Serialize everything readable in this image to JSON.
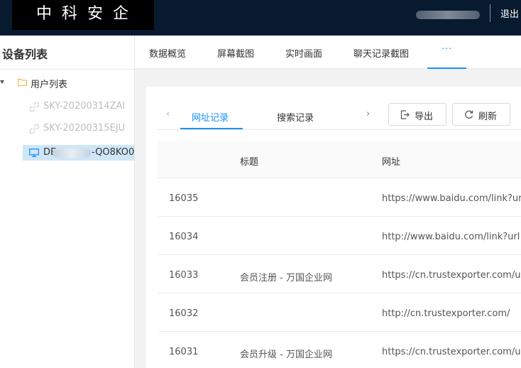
{
  "header": {
    "logo_text": "中科安企",
    "logout_label": "退出"
  },
  "sidebar": {
    "title": "设备列表",
    "root_label": "用户列表",
    "devices": [
      {
        "label": "SKY-20200314ZAI"
      },
      {
        "label": "SKY-20200315EJU"
      }
    ],
    "active_device": {
      "label_prefix": "DE",
      "label_suffix": "-QO8KO0"
    }
  },
  "tabs": {
    "items": [
      {
        "label": "数据概览"
      },
      {
        "label": "屏幕截图"
      },
      {
        "label": "实时画面"
      },
      {
        "label": "聊天记录截图"
      }
    ],
    "more_label": "···"
  },
  "panel": {
    "prev_arrow": "‹",
    "next_arrow": "›",
    "subtabs": [
      {
        "label": "网址记录",
        "active": true
      },
      {
        "label": "搜索记录",
        "active": false
      }
    ],
    "export_label": "导出",
    "refresh_label": "刷新"
  },
  "table": {
    "columns": [
      "标题",
      "网址"
    ],
    "rows": [
      {
        "id": "16035",
        "title": "",
        "url": "https://www.baidu.com/link?url"
      },
      {
        "id": "16034",
        "title": "",
        "url": "http://www.baidu.com/link?url"
      },
      {
        "id": "16033",
        "title": "会员注册 - 万国企业网",
        "url": "https://cn.trustexporter.com/u"
      },
      {
        "id": "16032",
        "title": "",
        "url": "http://cn.trustexporter.com/"
      },
      {
        "id": "16031",
        "title": "会员升级 - 万国企业网",
        "url": "https://cn.trustexporter.com/u"
      }
    ]
  },
  "colors": {
    "topbar": "#071a2e",
    "accent": "#1890ff",
    "active_row": "#cfe6f7"
  }
}
